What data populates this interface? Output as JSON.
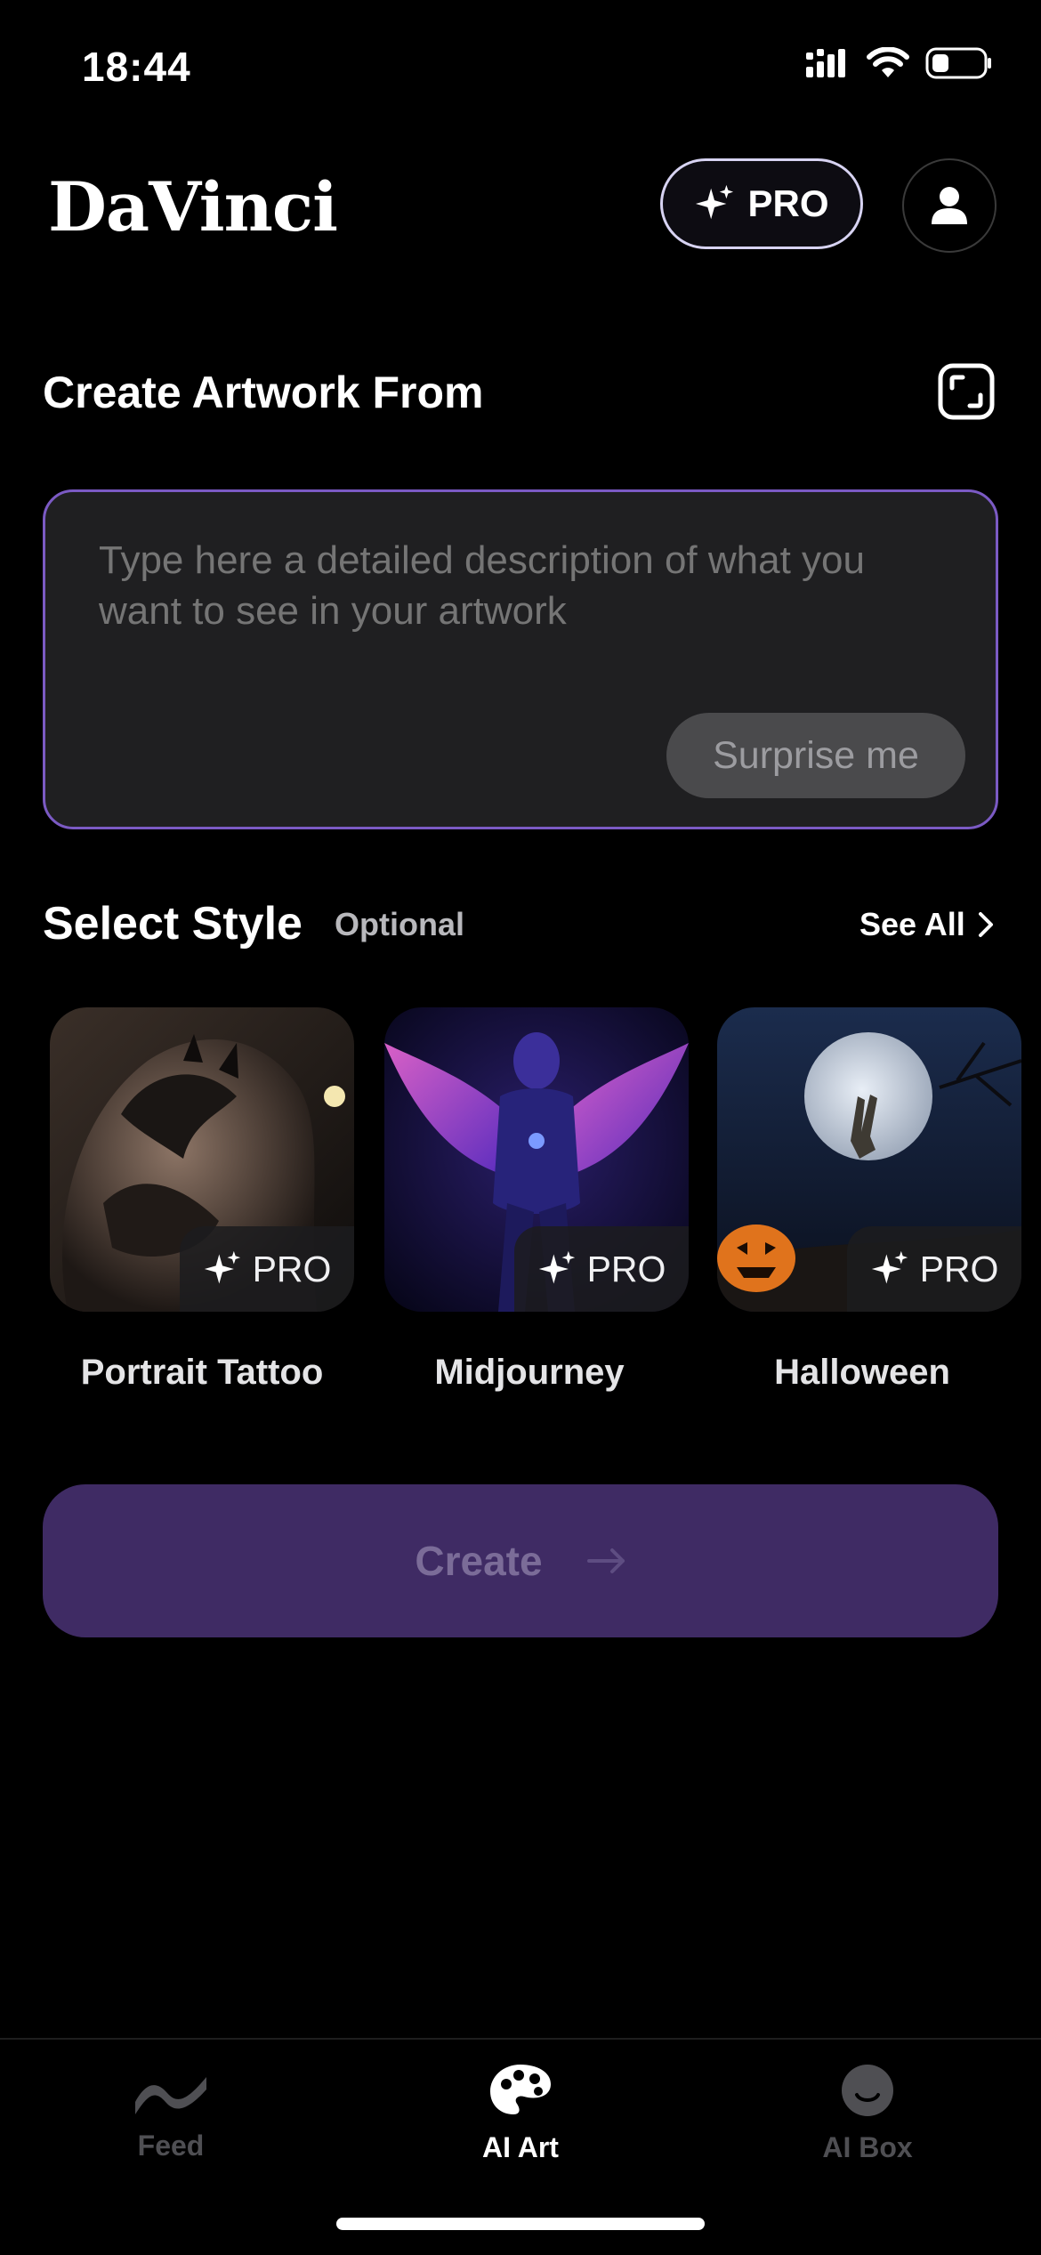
{
  "status_bar": {
    "time": "18:44"
  },
  "header": {
    "logo": "DaVinci",
    "pro_label": "PRO"
  },
  "create_section": {
    "title": "Create Artwork From",
    "prompt_placeholder": "Type here a detailed description of what you want to see in your artwork",
    "surprise_label": "Surprise me"
  },
  "style_section": {
    "title": "Select Style",
    "optional_label": "Optional",
    "see_all_label": "See All",
    "cards": [
      {
        "label": "Portrait Tattoo",
        "badge": "PRO"
      },
      {
        "label": "Midjourney",
        "badge": "PRO"
      },
      {
        "label": "Halloween",
        "badge": "PRO"
      }
    ]
  },
  "create_button": {
    "label": "Create"
  },
  "tab_bar": {
    "tabs": [
      {
        "label": "Feed",
        "active": false
      },
      {
        "label": "AI Art",
        "active": true
      },
      {
        "label": "AI Box",
        "active": false
      }
    ]
  },
  "colors": {
    "accent": "#7b5ac4",
    "create_bg": "#3f2b64"
  }
}
